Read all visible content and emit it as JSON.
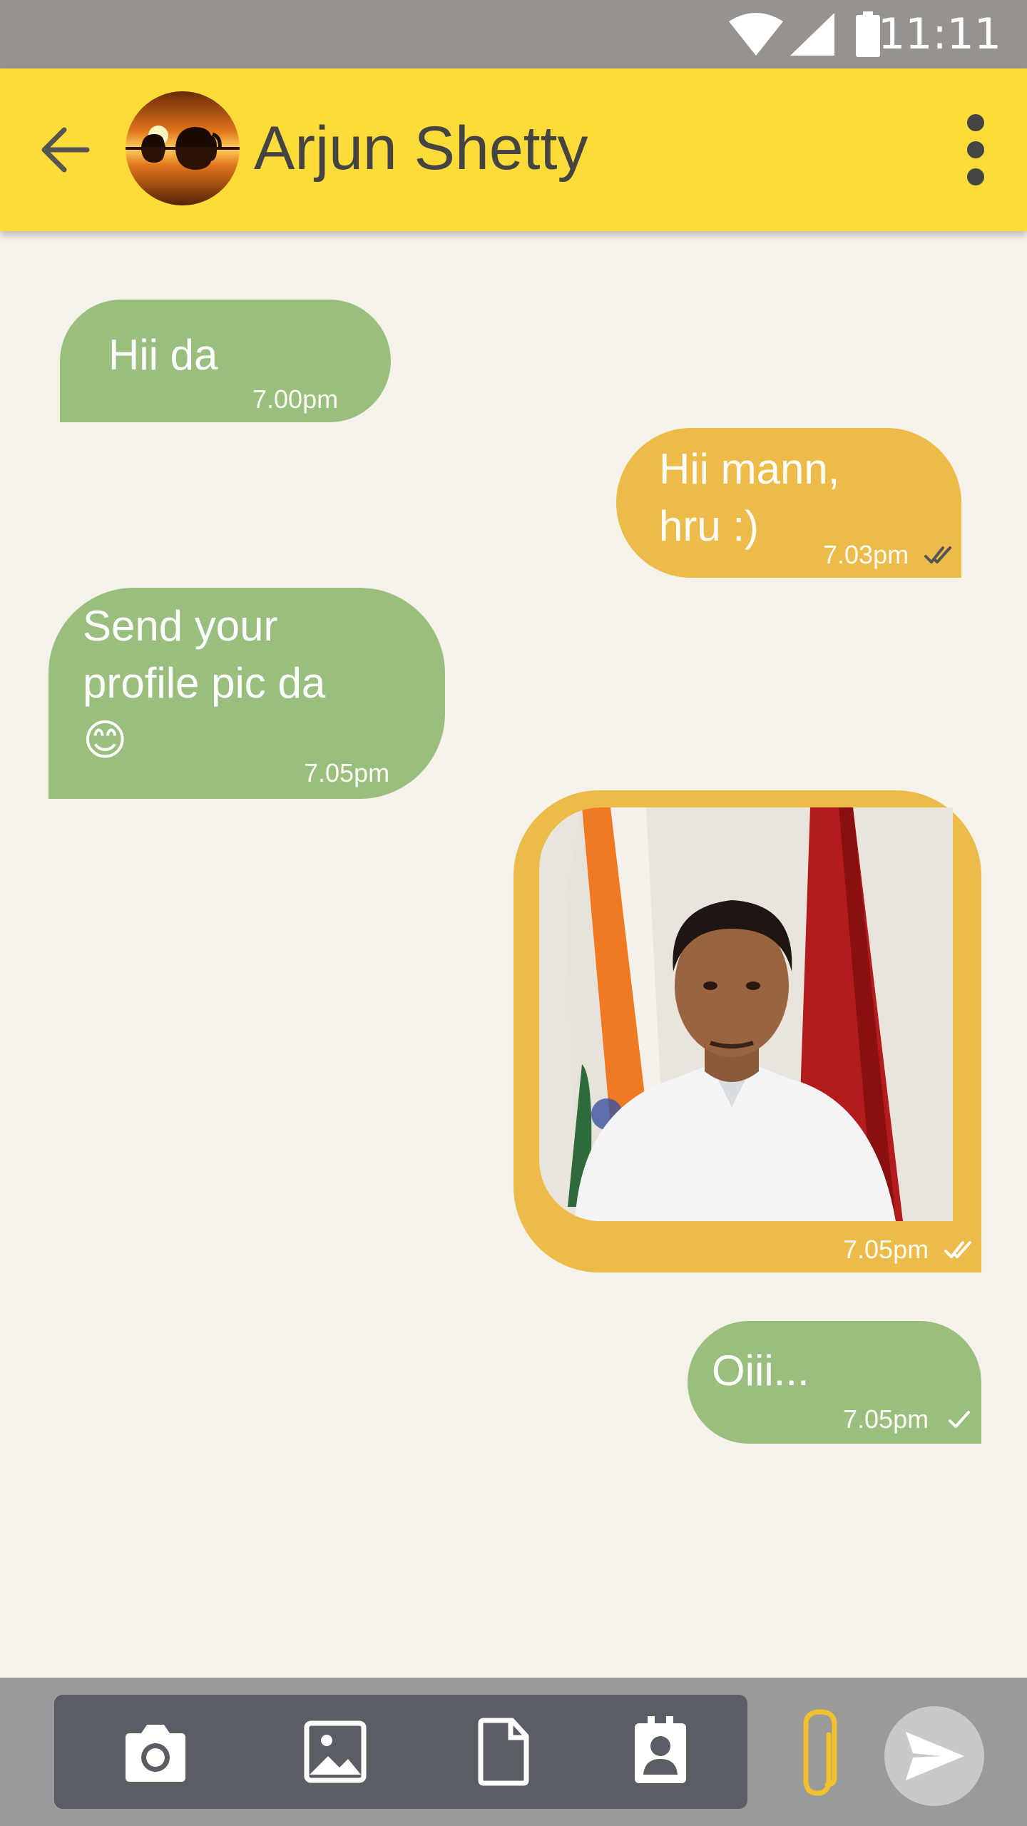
{
  "status_bar": {
    "time": "11:11"
  },
  "header": {
    "contact_name": "Arjun Shetty",
    "back_icon": "arrow-left",
    "menu_icon": "more-vertical"
  },
  "messages": [
    {
      "direction": "incoming",
      "text": "Hii da",
      "time": "7.00pm"
    },
    {
      "direction": "outgoing",
      "text": "Hii mann,\nhru :)",
      "time": "7.03pm",
      "status": "read"
    },
    {
      "direction": "incoming",
      "text": "Send your\nprofile pic da\n😊",
      "time": "7.05pm"
    },
    {
      "direction": "outgoing",
      "type": "image",
      "time": "7.05pm",
      "status": "read"
    },
    {
      "direction": "outgoing",
      "text": "Oiii...",
      "time": "7.05pm",
      "status": "sent"
    }
  ],
  "composer": {
    "attach_options": [
      "camera-icon",
      "gallery-icon",
      "document-icon",
      "contact-icon"
    ],
    "clip_icon": "paperclip",
    "send_icon": "send"
  },
  "colors": {
    "app_bar": "#FDDC3A",
    "incoming_bubble": "#99BE7E",
    "outgoing_bubble": "#EDBB4A",
    "background": "#F4F2E9",
    "status_bar": "#96938E"
  }
}
